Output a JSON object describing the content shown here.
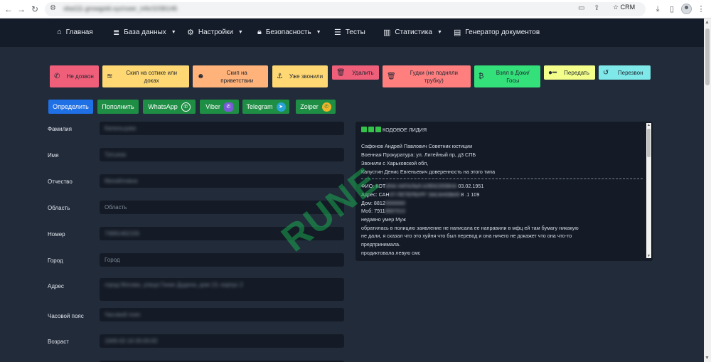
{
  "browser": {
    "url": "vba111.growgold.xyz/user_info/1036146",
    "profile_label": "CRM"
  },
  "navbar": {
    "items": [
      {
        "label": "Главная",
        "icon": "home-icon"
      },
      {
        "label": "База данных",
        "icon": "database-icon",
        "dropdown": true
      },
      {
        "label": "Настройки",
        "icon": "gear-icon",
        "dropdown": true
      },
      {
        "label": "Безопасность",
        "icon": "lock-icon",
        "dropdown": true
      },
      {
        "label": "Тесты",
        "icon": "list-icon"
      },
      {
        "label": "Статистика",
        "icon": "chart-icon",
        "dropdown": true
      },
      {
        "label": "Генератор документов",
        "icon": "document-icon"
      }
    ]
  },
  "actions": [
    {
      "label": "Не дозвон",
      "color": "#ef5f7a",
      "icon": "phone-off-icon"
    },
    {
      "label": "Скип на сотике или доках",
      "color": "#ffd873",
      "icon": "waves-icon"
    },
    {
      "label": "Скип на приветствии",
      "color": "#ffb37a",
      "icon": "robot-icon"
    },
    {
      "label": "Уже звонили",
      "color": "#ffd873",
      "icon": "anchor-icon"
    },
    {
      "label": "Удалить",
      "color": "#ef5f7a",
      "icon": "trash-icon"
    },
    {
      "label": "Гудки (не подняли трубку)",
      "color": "#ff7f7f",
      "icon": "trash-icon"
    },
    {
      "label": "Взял в Доки/ Госы",
      "color": "#34e07a",
      "icon": "bitcoin-icon"
    },
    {
      "label": "Передать",
      "color": "#f3ff8a",
      "icon": "key-icon"
    },
    {
      "label": "Перезвон",
      "color": "#7fe9ea",
      "icon": "history-icon"
    }
  ],
  "messengers": [
    {
      "label": "Определить",
      "color": "#1f6fe5"
    },
    {
      "label": "Пополнить",
      "color": "#1e8e45"
    },
    {
      "label": "WhatsApp",
      "color": "#1e8e45"
    },
    {
      "label": "Viber",
      "color": "#1e8e45"
    },
    {
      "label": "Telegram",
      "color": "#1e8e45"
    },
    {
      "label": "Zoiper",
      "color": "#1e8e45"
    }
  ],
  "form": [
    {
      "label": "Фамилия",
      "value": "Капельцова"
    },
    {
      "label": "Имя",
      "value": "Татьяна"
    },
    {
      "label": "Отчество",
      "value": "Михайловна"
    },
    {
      "label": "Область",
      "value": "Область"
    },
    {
      "label": "Номер",
      "value": "74991462156"
    },
    {
      "label": "Город",
      "value": "Город"
    },
    {
      "label": "Адрес",
      "value": "город Москва, улица Генке Дудича, дом 13, корпус 2"
    },
    {
      "label": "Часовой пояс",
      "value": "Часовой пояс"
    },
    {
      "label": "Возраст",
      "value": "1949-02-16 00:00:00"
    }
  ],
  "notes": {
    "header": "КОДОВОЕ ЛИДИЯ",
    "lines": [
      "Сафонов Андрей Павлович  Советник юстиции",
      "Военная Прокуратура: ул. Литейный пр, д3    СПБ",
      "Звонили с Харьковской обл,",
      "Капустин Денис Евгеньевич доверенность на этого типа"
    ],
    "lines2": [
      {
        "prefix": "ФИО: КОТ",
        "blur": "ИНА НАТАЛЬЯ АЛЕКСЕЕВНА",
        "suffix": " 03.02.1951"
      },
      {
        "prefix": "Адрес: САН",
        "blur": "КТ-ПЕТЕРБУРГ ЗАСАНОВАЯ",
        "suffix": " 8 .1 109"
      },
      {
        "prefix": "Дом: 8812",
        "blur": "0000000",
        "suffix": ""
      },
      {
        "prefix": "Моб: 7911",
        "blur": "8697013",
        "suffix": ""
      }
    ],
    "lines3": [
      "недавно умер Муж",
      "обратилась в полицию заявление не написала ее направили в мфц ей там бумагу никакую",
      "не дали, я сказал что это хуйня что был перевод и она ничего не докажет что она что-то",
      "предпринимала.",
      "продиктовала левую смс"
    ]
  },
  "watermark": "RUNE"
}
